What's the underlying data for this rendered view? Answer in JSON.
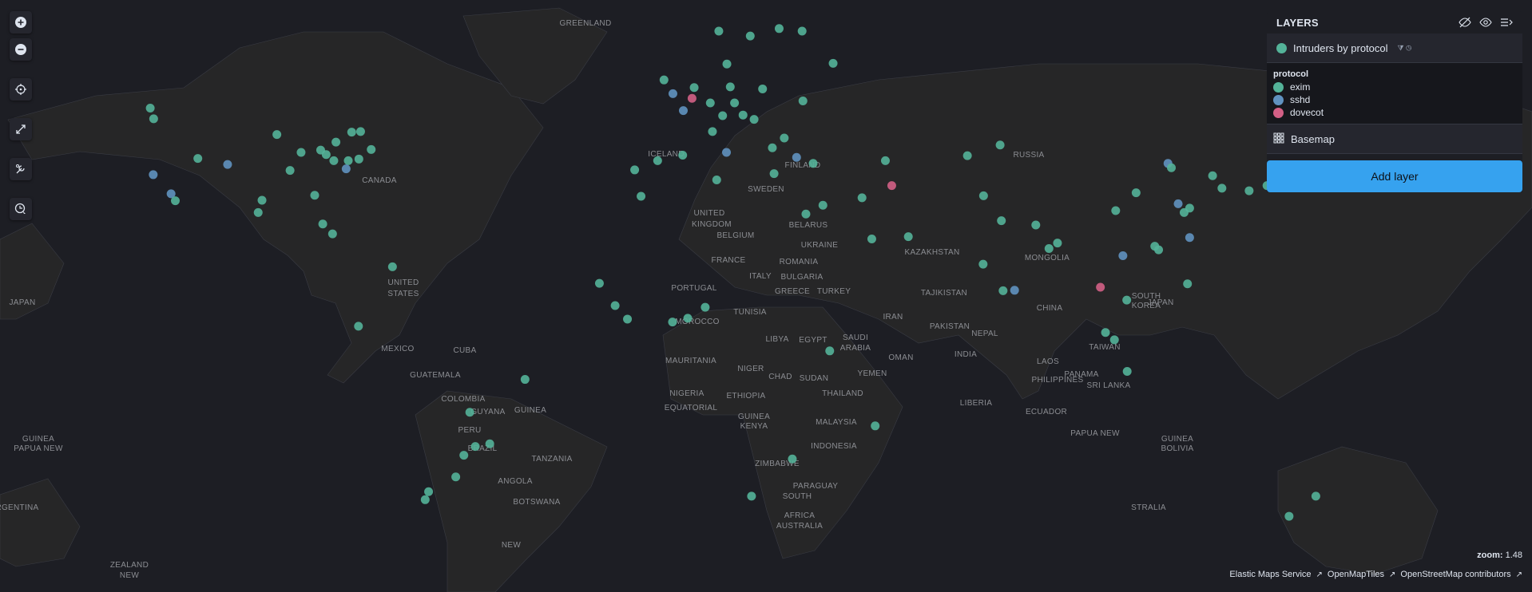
{
  "layers_panel": {
    "title": "LAYERS",
    "layer_name": "Intruders by protocol",
    "legend_title": "protocol",
    "legend": [
      {
        "label": "exim",
        "color": "#54b399"
      },
      {
        "label": "sshd",
        "color": "#6092c0"
      },
      {
        "label": "dovecot",
        "color": "#d36086"
      }
    ],
    "basemap_label": "Basemap",
    "add_layer_label": "Add layer"
  },
  "zoom": {
    "label": "zoom:",
    "value": "1.48"
  },
  "attribution": [
    "Elastic Maps Service",
    "OpenMapTiles",
    "OpenStreetMap contributors"
  ],
  "place_labels": [
    "GREENLAND",
    "ICELAND",
    "RUSSIA",
    "CANADA",
    "FINLAND",
    "SWEDEN",
    "UNITED",
    "KINGDOM",
    "BELARUS",
    "BELGIUM",
    "UKRAINE",
    "FRANCE",
    "ROMANIA",
    "KAZAKHSTAN",
    "MONGOLIA",
    "UNITED",
    "STATES",
    "JAPAN",
    "PORTUGAL",
    "ITALY",
    "BULGARIA",
    "GREECE",
    "TURKEY",
    "TAJIKISTAN",
    "SOUTH",
    "KOREA",
    "JAPAN",
    "CHINA",
    "MOROCCO",
    "TUNISIA",
    "IRAN",
    "LIBYA",
    "EGYPT",
    "SAUDI",
    "ARABIA",
    "PAKISTAN",
    "NEPAL",
    "MEXICO",
    "CUBA",
    "GUATEMALA",
    "MAURITANIA",
    "NIGER",
    "CHAD",
    "SUDAN",
    "YEMEN",
    "OMAN",
    "INDIA",
    "LAOS",
    "TAIWAN",
    "PANAMA",
    "COLOMBIA",
    "GUYANA",
    "GUINEA",
    "NIGERIA",
    "ETHIOPIA",
    "THAILAND",
    "PHILIPPINES",
    "SRI LANKA",
    "LIBERIA",
    "EQUATORIAL",
    "GUINEA",
    "KENYA",
    "MALAYSIA",
    "ECUADOR",
    "PERU",
    "BRAZIL",
    "TANZANIA",
    "INDONESIA",
    "PAPUA NEW",
    "GUINEA",
    "PAPUA NEW",
    "GUINEA",
    "BOLIVIA",
    "ANGOLA",
    "ZIMBABWE",
    "PARAGUAY",
    "BOTSWANA",
    "SOUTH",
    "AFRICA",
    "AUSTRALIA",
    "STRALIA",
    "ARGENTINA",
    "NEW",
    "ZEALAND",
    "NEW"
  ],
  "points": [
    {
      "lon": -76.5,
      "lat": 40.4,
      "protocol": "exim"
    },
    {
      "lon": -77.0,
      "lat": 38.9,
      "protocol": "sshd"
    },
    {
      "lon": -74.0,
      "lat": 40.7,
      "protocol": "exim"
    },
    {
      "lon": -71.1,
      "lat": 42.4,
      "protocol": "exim"
    },
    {
      "lon": -79.4,
      "lat": 43.7,
      "protocol": "exim"
    },
    {
      "lon": -73.6,
      "lat": 45.5,
      "protocol": "exim"
    },
    {
      "lon": -83.0,
      "lat": 42.3,
      "protocol": "exim"
    },
    {
      "lon": -87.6,
      "lat": 41.9,
      "protocol": "exim"
    },
    {
      "lon": -84.4,
      "lat": 33.8,
      "protocol": "exim"
    },
    {
      "lon": -80.2,
      "lat": 25.8,
      "protocol": "exim"
    },
    {
      "lon": -97.7,
      "lat": 30.3,
      "protocol": "exim"
    },
    {
      "lon": -96.8,
      "lat": 32.8,
      "protocol": "exim"
    },
    {
      "lon": -104.9,
      "lat": 39.7,
      "protocol": "sshd"
    },
    {
      "lon": -111.9,
      "lat": 40.8,
      "protocol": "exim"
    },
    {
      "lon": -122.4,
      "lat": 37.8,
      "protocol": "sshd"
    },
    {
      "lon": -118.2,
      "lat": 34.1,
      "protocol": "sshd"
    },
    {
      "lon": -117.2,
      "lat": 32.7,
      "protocol": "exim"
    },
    {
      "lon": -122.3,
      "lat": 47.6,
      "protocol": "exim"
    },
    {
      "lon": -123.1,
      "lat": 49.3,
      "protocol": "exim"
    },
    {
      "lon": -90.2,
      "lat": 38.6,
      "protocol": "exim"
    },
    {
      "lon": -93.3,
      "lat": 45.0,
      "protocol": "exim"
    },
    {
      "lon": -81.7,
      "lat": 41.5,
      "protocol": "exim"
    },
    {
      "lon": -82.5,
      "lat": 27.9,
      "protocol": "exim"
    },
    {
      "lon": -66.1,
      "lat": 18.5,
      "protocol": "exim"
    },
    {
      "lon": -75.7,
      "lat": 45.4,
      "protocol": "exim"
    },
    {
      "lon": -79.9,
      "lat": 40.4,
      "protocol": "exim"
    },
    {
      "lon": -74.1,
      "lat": 4.6,
      "protocol": "exim"
    },
    {
      "lon": -43.2,
      "lat": -22.9,
      "protocol": "exim"
    },
    {
      "lon": -46.6,
      "lat": -23.5,
      "protocol": "exim"
    },
    {
      "lon": -47.9,
      "lat": -15.8,
      "protocol": "exim"
    },
    {
      "lon": -49.3,
      "lat": -25.4,
      "protocol": "exim"
    },
    {
      "lon": -51.2,
      "lat": -30.0,
      "protocol": "exim"
    },
    {
      "lon": -34.9,
      "lat": -8.1,
      "protocol": "exim"
    },
    {
      "lon": -58.4,
      "lat": -34.6,
      "protocol": "exim"
    },
    {
      "lon": -57.6,
      "lat": -33.0,
      "protocol": "exim"
    },
    {
      "lon": -0.1,
      "lat": 51.5,
      "protocol": "sshd"
    },
    {
      "lon": -2.2,
      "lat": 53.5,
      "protocol": "exim"
    },
    {
      "lon": 2.35,
      "lat": 48.9,
      "protocol": "sshd"
    },
    {
      "lon": 4.4,
      "lat": 50.8,
      "protocol": "dovecot"
    },
    {
      "lon": 4.9,
      "lat": 52.4,
      "protocol": "exim"
    },
    {
      "lon": 13.4,
      "lat": 52.5,
      "protocol": "exim"
    },
    {
      "lon": 8.7,
      "lat": 50.1,
      "protocol": "exim"
    },
    {
      "lon": 11.6,
      "lat": 48.1,
      "protocol": "exim"
    },
    {
      "lon": 16.4,
      "lat": 48.2,
      "protocol": "exim"
    },
    {
      "lon": 21.0,
      "lat": 52.2,
      "protocol": "exim"
    },
    {
      "lon": 14.4,
      "lat": 50.1,
      "protocol": "exim"
    },
    {
      "lon": 19.0,
      "lat": 47.5,
      "protocol": "exim"
    },
    {
      "lon": 12.5,
      "lat": 41.9,
      "protocol": "sshd"
    },
    {
      "lon": 9.2,
      "lat": 45.5,
      "protocol": "exim"
    },
    {
      "lon": -3.7,
      "lat": 40.4,
      "protocol": "exim"
    },
    {
      "lon": 2.2,
      "lat": 41.4,
      "protocol": "exim"
    },
    {
      "lon": -9.1,
      "lat": 38.7,
      "protocol": "exim"
    },
    {
      "lon": 18.1,
      "lat": 59.3,
      "protocol": "exim"
    },
    {
      "lon": 10.7,
      "lat": 59.9,
      "protocol": "exim"
    },
    {
      "lon": 12.6,
      "lat": 55.7,
      "protocol": "exim"
    },
    {
      "lon": 24.9,
      "lat": 60.2,
      "protocol": "exim"
    },
    {
      "lon": 30.3,
      "lat": 59.9,
      "protocol": "exim"
    },
    {
      "lon": 37.6,
      "lat": 55.8,
      "protocol": "exim"
    },
    {
      "lon": 30.5,
      "lat": 50.4,
      "protocol": "exim"
    },
    {
      "lon": 26.1,
      "lat": 44.4,
      "protocol": "exim"
    },
    {
      "lon": 23.3,
      "lat": 42.7,
      "protocol": "exim"
    },
    {
      "lon": 23.7,
      "lat": 38.0,
      "protocol": "exim"
    },
    {
      "lon": 29.0,
      "lat": 41.0,
      "protocol": "sshd"
    },
    {
      "lon": 32.9,
      "lat": 39.9,
      "protocol": "exim"
    },
    {
      "lon": 35.2,
      "lat": 31.8,
      "protocol": "exim"
    },
    {
      "lon": 51.4,
      "lat": 35.7,
      "protocol": "dovecot"
    },
    {
      "lon": 46.7,
      "lat": 24.7,
      "protocol": "exim"
    },
    {
      "lon": 55.3,
      "lat": 25.2,
      "protocol": "exim"
    },
    {
      "lon": 44.4,
      "lat": 33.3,
      "protocol": "exim"
    },
    {
      "lon": 49.9,
      "lat": 40.4,
      "protocol": "exim"
    },
    {
      "lon": 69.2,
      "lat": 41.3,
      "protocol": "exim"
    },
    {
      "lon": 76.9,
      "lat": 43.2,
      "protocol": "exim"
    },
    {
      "lon": 73.0,
      "lat": 33.7,
      "protocol": "exim"
    },
    {
      "lon": 77.2,
      "lat": 28.6,
      "protocol": "exim"
    },
    {
      "lon": 72.9,
      "lat": 19.1,
      "protocol": "exim"
    },
    {
      "lon": 80.3,
      "lat": 13.1,
      "protocol": "sshd"
    },
    {
      "lon": 77.6,
      "lat": 13.0,
      "protocol": "exim"
    },
    {
      "lon": 88.4,
      "lat": 22.6,
      "protocol": "exim"
    },
    {
      "lon": 85.3,
      "lat": 27.7,
      "protocol": "exim"
    },
    {
      "lon": 90.4,
      "lat": 23.8,
      "protocol": "exim"
    },
    {
      "lon": 100.5,
      "lat": 13.8,
      "protocol": "dovecot"
    },
    {
      "lon": 106.7,
      "lat": 10.8,
      "protocol": "exim"
    },
    {
      "lon": 105.8,
      "lat": 21.0,
      "protocol": "sshd"
    },
    {
      "lon": 101.7,
      "lat": 3.1,
      "protocol": "exim"
    },
    {
      "lon": 103.8,
      "lat": 1.35,
      "protocol": "exim"
    },
    {
      "lon": 106.8,
      "lat": -6.2,
      "protocol": "exim"
    },
    {
      "lon": 121.0,
      "lat": 14.6,
      "protocol": "exim"
    },
    {
      "lon": 114.2,
      "lat": 22.3,
      "protocol": "exim"
    },
    {
      "lon": 113.3,
      "lat": 23.1,
      "protocol": "exim"
    },
    {
      "lon": 121.5,
      "lat": 25.0,
      "protocol": "sshd"
    },
    {
      "lon": 121.5,
      "lat": 31.2,
      "protocol": "exim"
    },
    {
      "lon": 116.4,
      "lat": 39.9,
      "protocol": "sshd"
    },
    {
      "lon": 117.2,
      "lat": 39.1,
      "protocol": "exim"
    },
    {
      "lon": 104.1,
      "lat": 30.7,
      "protocol": "exim"
    },
    {
      "lon": 108.9,
      "lat": 34.3,
      "protocol": "exim"
    },
    {
      "lon": 120.2,
      "lat": 30.3,
      "protocol": "exim"
    },
    {
      "lon": 118.8,
      "lat": 32.1,
      "protocol": "sshd"
    },
    {
      "lon": 126.9,
      "lat": 37.6,
      "protocol": "exim"
    },
    {
      "lon": 129.1,
      "lat": 35.2,
      "protocol": "exim"
    },
    {
      "lon": 139.7,
      "lat": 35.7,
      "protocol": "exim"
    },
    {
      "lon": 135.5,
      "lat": 34.7,
      "protocol": "exim"
    },
    {
      "lon": 141.3,
      "lat": 43.1,
      "protocol": "exim"
    },
    {
      "lon": 151.2,
      "lat": -33.9,
      "protocol": "exim"
    },
    {
      "lon": 144.9,
      "lat": -37.8,
      "protocol": "exim"
    },
    {
      "lon": 3.4,
      "lat": 6.5,
      "protocol": "exim"
    },
    {
      "lon": -0.2,
      "lat": 5.6,
      "protocol": "exim"
    },
    {
      "lon": -17.4,
      "lat": 14.7,
      "protocol": "exim"
    },
    {
      "lon": -7.6,
      "lat": 33.6,
      "protocol": "exim"
    },
    {
      "lon": 10.2,
      "lat": 36.8,
      "protocol": "exim"
    },
    {
      "lon": 31.2,
      "lat": 30.0,
      "protocol": "exim"
    },
    {
      "lon": 36.8,
      "lat": -1.3,
      "protocol": "exim"
    },
    {
      "lon": 28.0,
      "lat": -26.2,
      "protocol": "exim"
    },
    {
      "lon": 18.4,
      "lat": -33.9,
      "protocol": "exim"
    },
    {
      "lon": 47.5,
      "lat": -18.9,
      "protocol": "exim"
    },
    {
      "lon": 7.5,
      "lat": 9.1,
      "protocol": "exim"
    },
    {
      "lon": -10.8,
      "lat": 6.3,
      "protocol": "exim"
    },
    {
      "lon": -13.7,
      "lat": 9.5,
      "protocol": "exim"
    }
  ]
}
